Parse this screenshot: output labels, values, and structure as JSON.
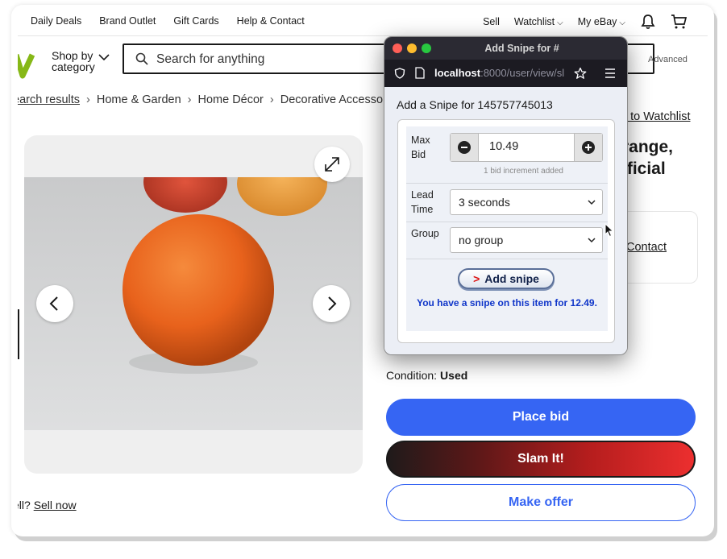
{
  "topnav": {
    "links": [
      "Daily Deals",
      "Brand Outlet",
      "Gift Cards",
      "Help & Contact"
    ],
    "sell": "Sell",
    "watchlist": "Watchlist",
    "myebay": "My eBay"
  },
  "header": {
    "shop_by_line1": "Shop by",
    "shop_by_line2": "category",
    "search_placeholder": "Search for anything",
    "advanced": "Advanced"
  },
  "breadcrumbs": [
    "earch results",
    "Home & Garden",
    "Home Décor",
    "Decorative Accesso"
  ],
  "listing": {
    "watchlist_link": "d to Watchlist",
    "title_line1": "range,",
    "title_line2": "ificial",
    "seller_contact": "Contact",
    "condition_label": "Condition:",
    "condition_value": "Used",
    "sell_prompt": "ell?",
    "sell_now": "Sell now",
    "place_bid": "Place bid",
    "slam_it": "Slam It!",
    "make_offer": "Make offer"
  },
  "popup": {
    "window_title": "Add Snipe for #",
    "url_host": "localhost",
    "url_rest": ":8000/user/view/sl",
    "heading": "Add a Snipe for 145757745013",
    "max_bid_label_1": "Max",
    "max_bid_label_2": "Bid",
    "max_bid_value": "10.49",
    "increment_hint": "1 bid increment added",
    "lead_time_label_1": "Lead",
    "lead_time_label_2": "Time",
    "lead_time_value": "3 seconds",
    "group_label": "Group",
    "group_value": "no group",
    "add_snipe": "Add snipe",
    "notice": "You have a snipe on this item for 12.49."
  },
  "colors": {
    "ebay_blue": "#3665f3",
    "logo_green": "#86b817",
    "notice_blue": "#1036c9"
  }
}
